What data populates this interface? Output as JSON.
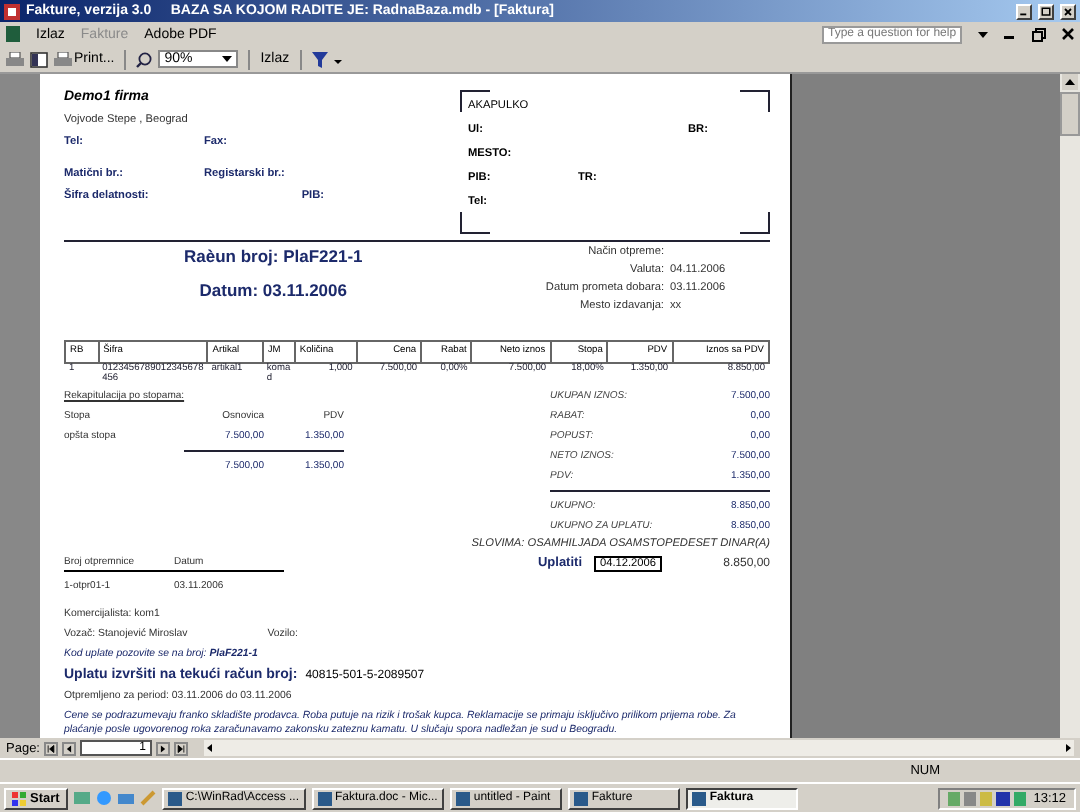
{
  "window": {
    "title": "Fakture, verzija 3.0     BAZA SA KOJOM RADITE JE: RadnaBaza.mdb - [Faktura]"
  },
  "menu": [
    {
      "label": "Izlaz",
      "disabled": false
    },
    {
      "label": "Fakture",
      "disabled": true
    },
    {
      "label": "Adobe PDF",
      "disabled": false
    }
  ],
  "help": {
    "placeholder": "Type a question for help"
  },
  "toolbar": {
    "print": "Print...",
    "zoom": "90%",
    "close": "Izlaz"
  },
  "invoice": {
    "company": {
      "name": "Demo1 firma",
      "address": "Vojvode Stepe , Beograd",
      "tel": "Tel:",
      "fax": "Fax:",
      "maticni": "Matični br.:",
      "registarski": "Registarski br.:",
      "sifra": "Šifra delatnosti:",
      "pib": "PIB:"
    },
    "customer": {
      "name": "AKAPULKO",
      "ul": "Ul:",
      "br": "BR:",
      "mesto": "MESTO:",
      "pib": "PIB:",
      "tr": "TR:",
      "tel": "Tel:"
    },
    "title": "Raèun broj: PlaF221-1",
    "date": "Datum: 03.11.2006",
    "meta": [
      {
        "label": "Način otpreme:"
      },
      {
        "label": "Valuta:",
        "value": "04.11.2006"
      },
      {
        "label": "Datum prometa dobara:",
        "value": "03.11.2006"
      },
      {
        "label": "Mesto izdavanja:",
        "value": "xx"
      }
    ],
    "items": {
      "columns": [
        "RB",
        "Šifra",
        "Artikal",
        "JM",
        "Količina",
        "Cena",
        "Rabat",
        "Neto iznos",
        "Stopa",
        "PDV",
        "Iznos sa PDV"
      ],
      "rows": [
        [
          "1",
          "0123456789012345678 456",
          "artikal1",
          "koma d",
          "1,000",
          "7.500,00",
          "0,00%",
          "7.500,00",
          "18,00%",
          "1.350,00",
          "8.850,00"
        ]
      ]
    },
    "recap": {
      "title": "Rekapitulacija po stopama:",
      "columns": [
        "Stopa",
        "Osnovica",
        "PDV"
      ],
      "rows": [
        [
          "opšta stopa",
          "7.500,00",
          "1.350,00"
        ]
      ],
      "totals": [
        "7.500,00",
        "1.350,00"
      ]
    },
    "summary": [
      {
        "label": "UKUPAN IZNOS:",
        "value": "7.500,00"
      },
      {
        "label": "RABAT:",
        "value": "0,00"
      },
      {
        "label": "POPUST:",
        "value": "0,00"
      },
      {
        "label": "NETO IZNOS:",
        "value": "7.500,00"
      },
      {
        "label": "PDV:",
        "value": "1.350,00"
      },
      {
        "label": "UKUPNO:",
        "value": "8.850,00"
      },
      {
        "label": "UKUPNO ZA UPLATU:",
        "value": "8.850,00"
      }
    ],
    "words": "SLOVIMA: OSAMHILJADA OSAMSTOPEDESET DINAR(A)",
    "pay": {
      "label": "Uplatiti",
      "date": "04.12.2006",
      "amount": "8.850,00"
    },
    "dispatch": {
      "columns": [
        "Broj otpremnice",
        "Datum"
      ],
      "rows": [
        [
          "1-otpr01-1",
          "03.11.2006"
        ]
      ]
    },
    "agent": "Komercijalista:  kom1",
    "driver": "Vozač:  Stanojević Miroslav",
    "vehicle": "Vozilo:",
    "reference": "Kod uplate pozovite se na broj:  **PlaF221-1**",
    "account_label": "Uplatu izvršiti na tekući račun broj:",
    "account": "40815-501-5-2089507",
    "period": "Otpremljeno za period: 03.11.2006 do 03.11.2006",
    "note": "Cene se podrazumevaju franko skladište prodavca. Roba putuje na rizik i trošak kupca. Reklamacije se primaju isključivo prilikom prijema robe. Za plaćanje posle ugovorenog roka zaračunavamo zakonsku zateznu kamatu. U slučaju spora nadležan je sud u Beogradu."
  },
  "pager": {
    "label": "Page:",
    "page": "1"
  },
  "status": {
    "indicator": "NUM"
  },
  "taskbar": {
    "start": "Start",
    "tasks": [
      {
        "label": "C:\\WinRad\\Access ...",
        "selected": false
      },
      {
        "label": "Faktura.doc - Mic...",
        "selected": false
      },
      {
        "label": "untitled - Paint",
        "selected": false
      },
      {
        "label": "Fakture",
        "selected": false
      },
      {
        "label": "Faktura",
        "selected": true
      }
    ],
    "clock": "13:12"
  }
}
